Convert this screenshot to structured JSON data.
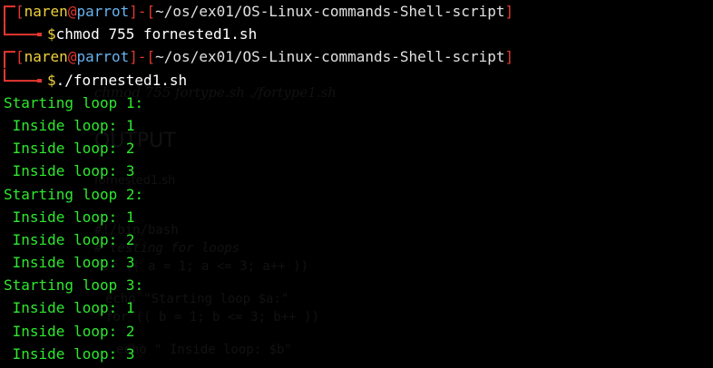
{
  "colors": {
    "background": "#000000",
    "prompt_bracket": "#e5372f",
    "prompt_user": "#f0d03c",
    "prompt_host": "#68b3f0",
    "prompt_path": "#e0e0e0",
    "command_text": "#ffffff",
    "output_text": "#2ee82e"
  },
  "prompts": [
    {
      "user": "naren",
      "at": "@",
      "host": "parrot",
      "separator": "]-[",
      "path": "~/os/ex01/OS-Linux-commands-Shell-script",
      "dollar": "$",
      "command": "chmod 755 fornested1.sh"
    },
    {
      "user": "naren",
      "at": "@",
      "host": "parrot",
      "separator": "]-[",
      "path": "~/os/ex01/OS-Linux-commands-Shell-script",
      "dollar": "$",
      "command": "./fornested1.sh"
    }
  ],
  "output_lines": [
    "Starting loop 1:",
    " Inside loop: 1",
    " Inside loop: 2",
    " Inside loop: 3",
    "Starting loop 2:",
    " Inside loop: 1",
    " Inside loop: 2",
    " Inside loop: 3",
    "Starting loop 3:",
    " Inside loop: 1",
    " Inside loop: 2",
    " Inside loop: 3"
  ],
  "background_ghost": {
    "lines": [
      "chmod 755 fortype.sh ./fortype1.sh",
      "OUTPUT",
      "fornested1.sh",
      "#!/bin/bash",
      "# testing for loops",
      "for (( a = 1; a <= 3; a++ ))",
      "echo \"Starting loop $a:\"",
      "for (( b = 1; b <= 3; b++ ))",
      "echo \" Inside loop: $b\""
    ]
  }
}
